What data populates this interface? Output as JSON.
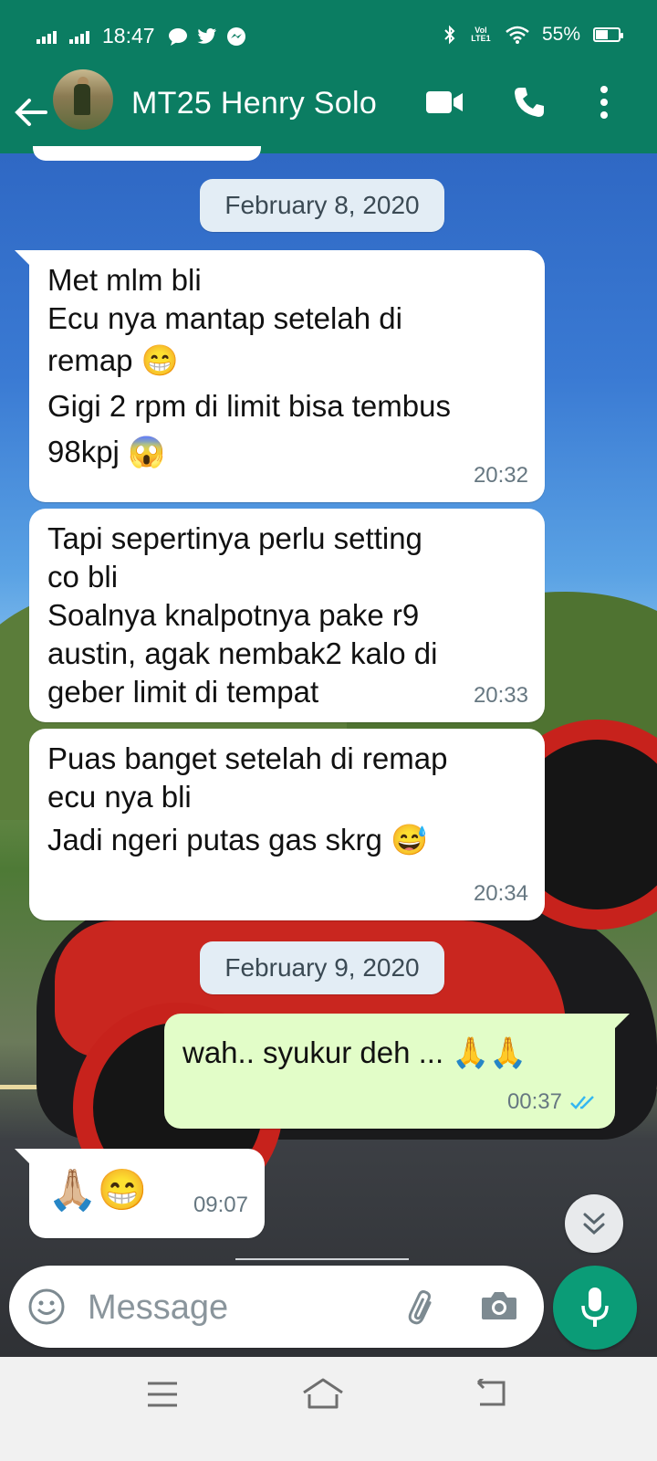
{
  "status_bar": {
    "time": "18:47",
    "battery": "55%",
    "battery_level": 0.55,
    "lte_label": "Vol LTE1",
    "left_icons": [
      "signal-icon",
      "signal-icon",
      "chat-bubble-icon",
      "twitter-icon",
      "messenger-icon"
    ],
    "right_icons": [
      "bluetooth-icon",
      "volte-icon",
      "wifi-icon",
      "battery-icon"
    ]
  },
  "header": {
    "contact_name": "MT25 Henry Solo",
    "icons": [
      "back-arrow-icon",
      "avatar",
      "video-call-icon",
      "phone-icon",
      "more-vert-icon"
    ]
  },
  "chat": {
    "date_1": "February 8, 2020",
    "date_2": "February 9, 2020",
    "messages": [
      {
        "direction": "incoming",
        "lines": [
          "Met mlm bli",
          "Ecu nya mantap setelah di",
          "remap 😁",
          "Gigi 2 rpm di limit bisa tembus",
          "98kpj 😱"
        ],
        "time": "20:32"
      },
      {
        "direction": "incoming",
        "lines": [
          "Tapi sepertinya perlu setting",
          "co bli",
          "Soalnya knalpotnya pake r9",
          "austin, agak nembak2 kalo di",
          "geber limit di tempat"
        ],
        "time": "20:33"
      },
      {
        "direction": "incoming",
        "lines": [
          "Puas banget setelah di remap",
          "ecu nya bli",
          "Jadi ngeri putas gas skrg 😅"
        ],
        "time": "20:34"
      },
      {
        "direction": "outgoing",
        "lines": [
          "wah.. syukur deh ... 🙏🙏"
        ],
        "time": "00:37",
        "status": "read"
      },
      {
        "direction": "incoming",
        "lines": [
          "🙏🏼😁"
        ],
        "time": "09:07"
      }
    ]
  },
  "composer": {
    "placeholder": "Message",
    "icons": [
      "emoji-icon",
      "attach-icon",
      "camera-icon",
      "mic-icon"
    ]
  },
  "nav_bar": {
    "icons": [
      "menu-icon",
      "home-icon",
      "back-icon"
    ]
  },
  "colors": {
    "header": "#0b7d62",
    "outgoing_bubble": "#e2fdc8",
    "incoming_bubble": "#ffffff",
    "date_chip": "#e3edf5",
    "mic_button": "#0b9c77",
    "read_ticks": "#34b7f1"
  }
}
